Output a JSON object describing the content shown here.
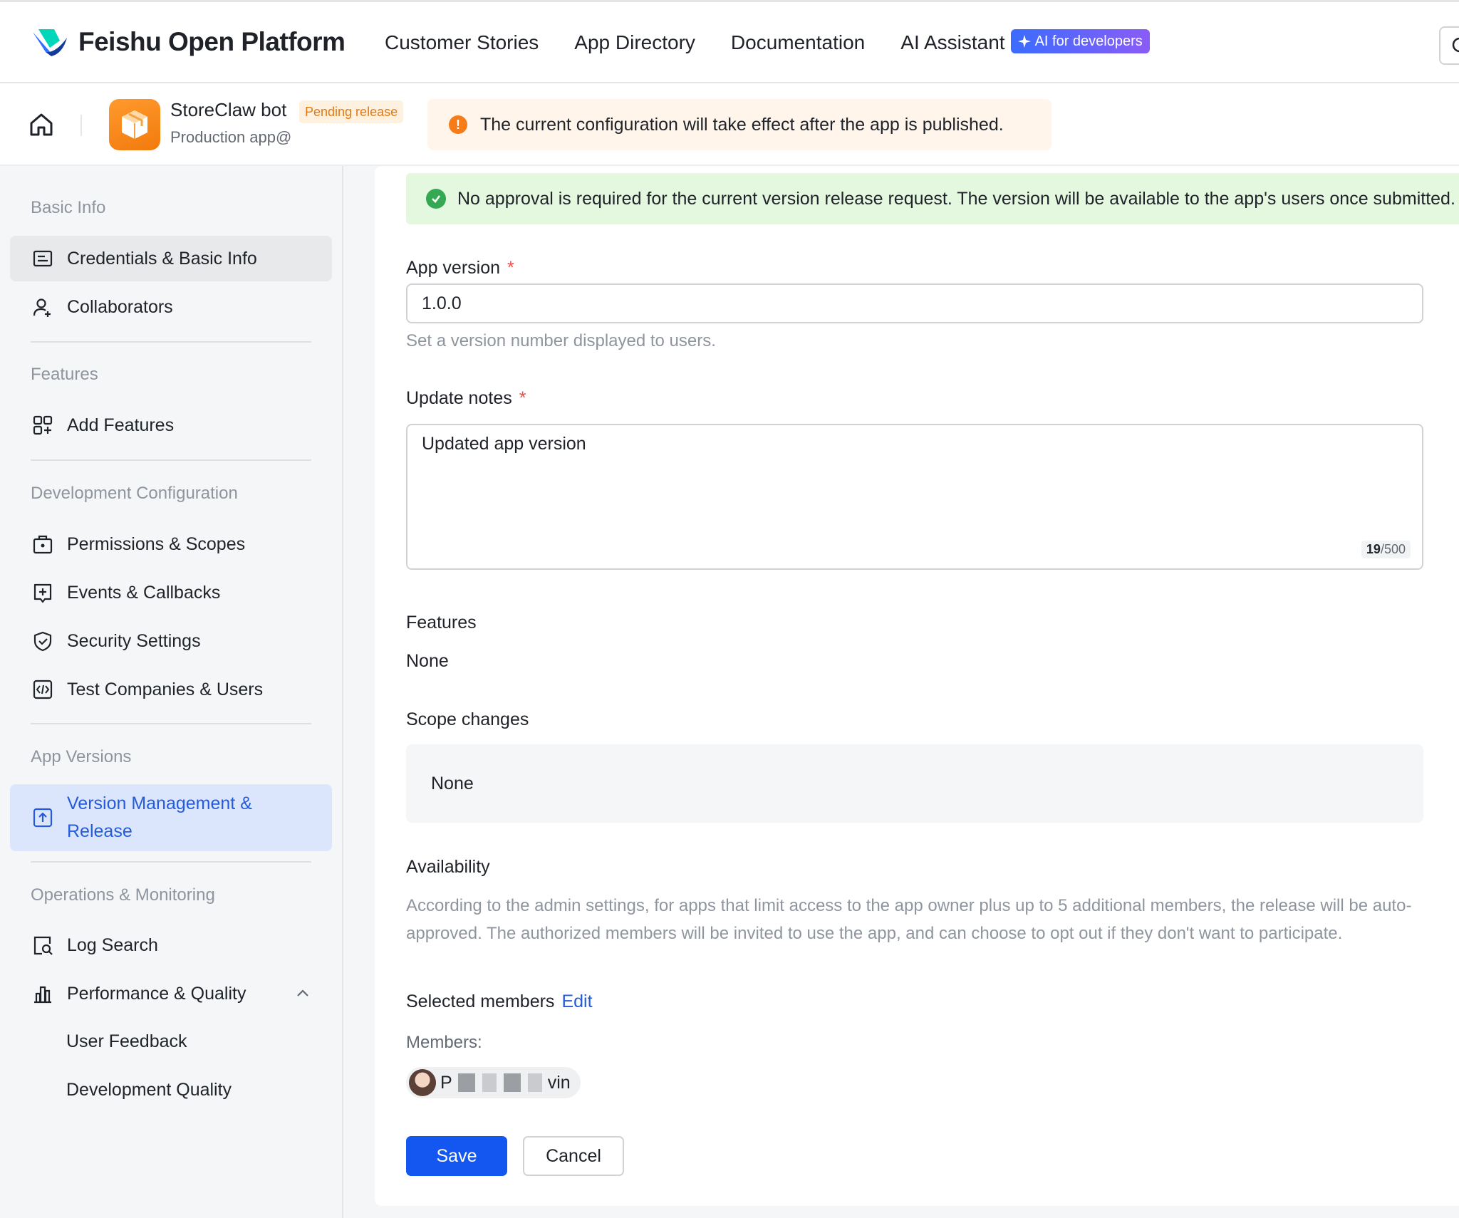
{
  "topnav": {
    "brand": "Feishu Open Platform",
    "links": [
      "Customer Stories",
      "App Directory",
      "Documentation",
      "AI Assistant"
    ],
    "ai_badge": "AI for developers"
  },
  "app": {
    "name": "StoreClaw bot",
    "status": "Pending release",
    "env": "Production app@",
    "notice": "The current configuration will take effect after the app is published."
  },
  "sidebar": {
    "basic_info": "Basic Info",
    "credentials": "Credentials & Basic Info",
    "collaborators": "Collaborators",
    "features": "Features",
    "add_features": "Add Features",
    "dev_config": "Development Configuration",
    "permissions": "Permissions & Scopes",
    "events": "Events & Callbacks",
    "security": "Security Settings",
    "test_companies": "Test Companies & Users",
    "app_versions": "App Versions",
    "version_mgmt": "Version Management & Release",
    "ops": "Operations & Monitoring",
    "log_search": "Log Search",
    "perf": "Performance & Quality",
    "user_feedback": "User Feedback",
    "dev_quality": "Development Quality"
  },
  "form": {
    "success_msg": "No approval is required for the current version release request. The version will be available to the app's users once submitted.",
    "version_label": "App version",
    "version_value": "1.0.0",
    "version_hint": "Set a version number displayed to users.",
    "notes_label": "Update notes",
    "notes_value": "Updated app version",
    "notes_count": "19",
    "notes_max": "/500",
    "features_label": "Features",
    "features_value": "None",
    "scope_label": "Scope changes",
    "scope_value": "None",
    "availability_label": "Availability",
    "availability_text": "According to the admin settings, for apps that limit access to the app owner plus up to 5 additional members, the release will be auto-approved. The authorized members will be invited to use the app, and can choose to opt out if they don't want to participate.",
    "selected_members": "Selected members",
    "edit": "Edit",
    "members_label": "Members:",
    "member_prefix": "P",
    "member_suffix": "vin",
    "save": "Save",
    "cancel": "Cancel"
  },
  "colors": {
    "accent": "#1456f0",
    "active_bg": "#dbe6fd",
    "warning": "#f77b16",
    "success": "#34a853"
  }
}
